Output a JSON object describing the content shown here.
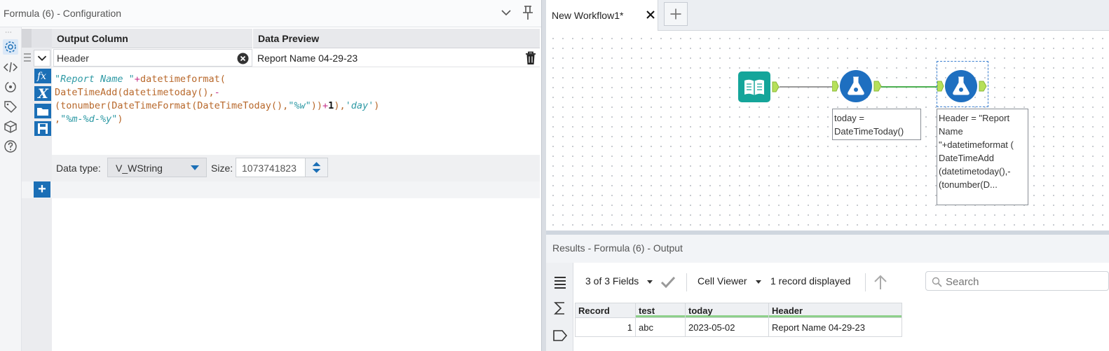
{
  "config": {
    "title": "Formula (6) - Configuration",
    "columns": {
      "output": "Output Column",
      "preview": "Data Preview"
    },
    "row": {
      "output_column": "Header",
      "preview": "Report Name 04-29-23"
    },
    "expression": {
      "line1_str": "\"Report Name \"",
      "line1_op": "+",
      "line1_fn": "datetimeformat(",
      "line2_fn": "DateTimeAdd(datetimetoday(),",
      "line2_op": "-",
      "line3_a": "(tonumber(DateTimeFormat(DateTimeToday(),",
      "line3_str": "\"%w\"",
      "line3_b": "))",
      "line3_op": "+",
      "line3_num": "1",
      "line3_c": "),",
      "line3_str2": "'day'",
      "line3_d": ")",
      "line4_a": ",",
      "line4_str": "\"%m-%d-%y\"",
      "line4_b": ")"
    },
    "data_type_label": "Data type:",
    "data_type_value": "V_WString",
    "size_label": "Size:",
    "size_value": "1073741823",
    "add_label": "+"
  },
  "workflow": {
    "tab_label": "New Workflow1*",
    "annotations": {
      "node2": "today = DateTimeToday()",
      "node3": "Header = \"Report Name \"+datetimeformat ( DateTimeAdd (datetimetoday(),- (tonumber(D..."
    }
  },
  "results": {
    "title": "Results - Formula (6) - Output",
    "fields": "3 of 3 Fields",
    "cell_viewer": "Cell Viewer",
    "record_count": "1 record displayed",
    "search_placeholder": "Search",
    "columns": [
      "Record",
      "test",
      "today",
      "Header"
    ],
    "rows": [
      {
        "record": "1",
        "test": "abc",
        "today": "2023-05-02",
        "header": "Report Name 04-29-23"
      }
    ]
  },
  "colors": {
    "accent": "#1b6fb6",
    "tool_teal": "#15a59a",
    "tool_blue": "#1e6fc0",
    "connector_green": "#4caf50"
  }
}
